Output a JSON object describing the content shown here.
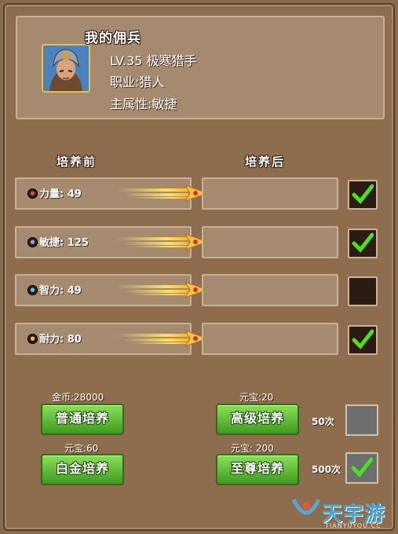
{
  "header": {
    "title": "我的佣兵",
    "level_line": "LV.35 极寒猎手",
    "job_line": "职业:猎人",
    "attr_line": "主属性:敏捷"
  },
  "columns": {
    "before": "培养前",
    "after": "培养后"
  },
  "stats": [
    {
      "icon": "strength-icon",
      "label": "力量: 49",
      "checked": true
    },
    {
      "icon": "agility-icon",
      "label": "敏捷: 125",
      "checked": true
    },
    {
      "icon": "intellect-icon",
      "label": "智力: 49",
      "checked": false
    },
    {
      "icon": "stamina-icon",
      "label": "耐力: 80",
      "checked": true
    }
  ],
  "training": {
    "normal": {
      "cost": "金币:28000",
      "label": "普通培养"
    },
    "advanced": {
      "cost": "元宝:20",
      "label": "高级培养"
    },
    "platinum": {
      "cost": "元宝:60",
      "label": "白金培养"
    },
    "supreme": {
      "cost": "元宝: 200",
      "label": "至尊培养"
    }
  },
  "batch": [
    {
      "label": "50次",
      "checked": false
    },
    {
      "label": "500次",
      "checked": true
    }
  ],
  "watermark": {
    "text": "天宇游",
    "sub": "TIANYUYOU.CC"
  },
  "colors": {
    "panel": "#a58a70",
    "background": "#8e6d4e",
    "button_green": "#5cbf2a",
    "check_green": "#4be21a"
  }
}
